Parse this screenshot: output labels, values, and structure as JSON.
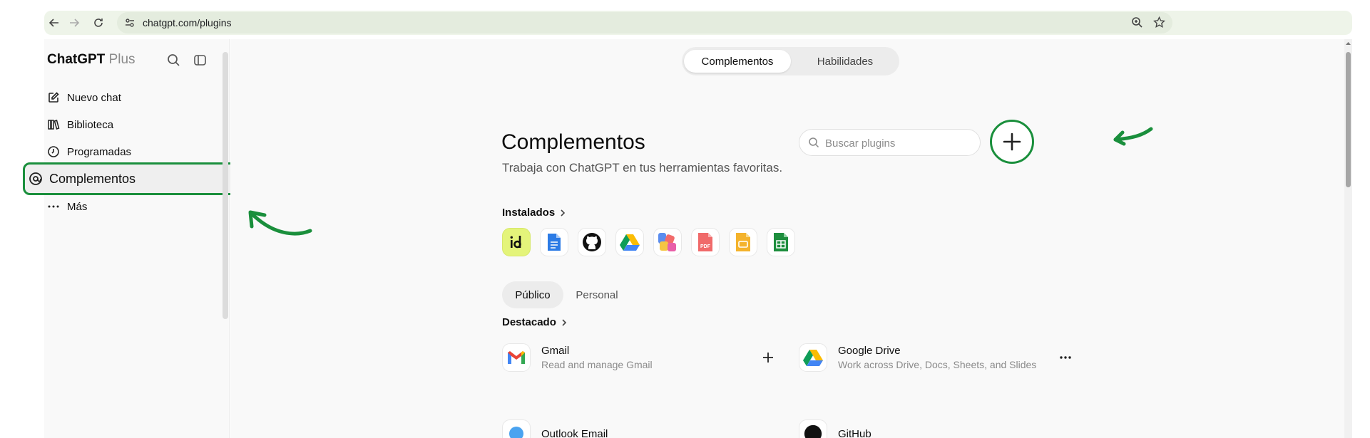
{
  "browser": {
    "url": "chatgpt.com/plugins"
  },
  "sidebar": {
    "brand": "ChatGPT",
    "brand_tier": "Plus",
    "items": [
      {
        "label": "Nuevo chat",
        "icon": "edit-icon"
      },
      {
        "label": "Biblioteca",
        "icon": "library-icon"
      },
      {
        "label": "Programadas",
        "icon": "clock-icon"
      },
      {
        "label": "Complementos",
        "icon": "plugin-icon"
      },
      {
        "label": "Más",
        "icon": "more-icon"
      }
    ]
  },
  "main": {
    "tabs": [
      {
        "label": "Complementos"
      },
      {
        "label": "Habilidades"
      }
    ],
    "title": "Complementos",
    "subtitle": "Trabaja con ChatGPT en tus herramientas favoritas.",
    "search_placeholder": "Buscar plugins",
    "installed_label": "Instalados",
    "installed_icons": [
      "id-app-icon",
      "google-docs-icon",
      "github-icon",
      "google-drive-icon",
      "multicolor-app-icon",
      "pdf-icon",
      "slides-icon",
      "google-sheets-icon"
    ],
    "filters": [
      {
        "label": "Público"
      },
      {
        "label": "Personal"
      }
    ],
    "featured_label": "Destacado",
    "featured": [
      {
        "name": "Gmail",
        "desc": "Read and manage Gmail",
        "action": "plus-icon"
      },
      {
        "name": "Google Drive",
        "desc": "Work across Drive, Docs, Sheets, and Slides",
        "action": "ellipsis-icon"
      },
      {
        "name": "Outlook Email",
        "desc": ""
      },
      {
        "name": "GitHub",
        "desc": ""
      }
    ]
  },
  "colors": {
    "highlight": "#1a8f3c",
    "browser_bar": "#eef4e9",
    "panel": "#f9f9f9"
  }
}
